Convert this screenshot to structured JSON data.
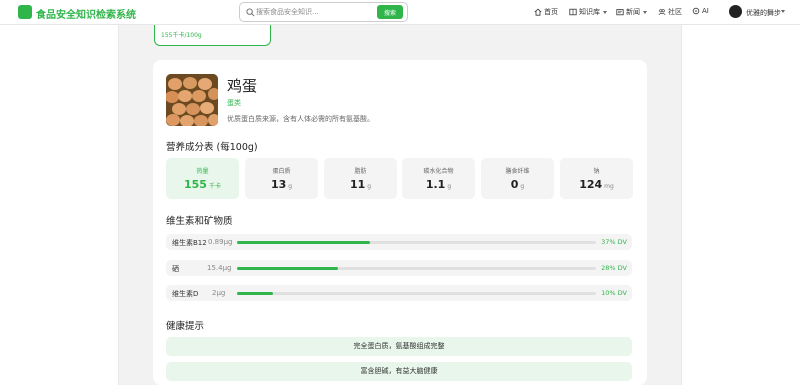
{
  "header": {
    "app_title": "食品安全知识检索系统",
    "search_placeholder": "搜索食品安全知识...",
    "search_button": "搜索",
    "nav": [
      {
        "label": "首页",
        "icon": "home-icon"
      },
      {
        "label": "知识库",
        "icon": "book-icon"
      },
      {
        "label": "新闻",
        "icon": "news-icon"
      },
      {
        "label": "社区",
        "icon": "community-icon"
      },
      {
        "label": "AI",
        "icon": "ai-icon"
      }
    ],
    "user_name": "优雅的舞步"
  },
  "prev_card": {
    "text": "155千卡/100g"
  },
  "food": {
    "name": "鸡蛋",
    "category": "蛋类",
    "description": "优质蛋白质来源，含有人体必需的所有氨基酸。"
  },
  "nutrition": {
    "title": "营养成分表 (每100g)",
    "items": [
      {
        "label": "热量",
        "value": "155",
        "unit": "千卡"
      },
      {
        "label": "蛋白质",
        "value": "13",
        "unit": "g"
      },
      {
        "label": "脂肪",
        "value": "11",
        "unit": "g"
      },
      {
        "label": "碳水化合物",
        "value": "1.1",
        "unit": "g"
      },
      {
        "label": "膳食纤维",
        "value": "0",
        "unit": "g"
      },
      {
        "label": "钠",
        "value": "124",
        "unit": "mg"
      }
    ]
  },
  "vitamins": {
    "title": "维生素和矿物质",
    "items": [
      {
        "name": "维生素B12",
        "amount": "0.89μg",
        "dv_label": "37% DV",
        "dv": 37
      },
      {
        "name": "硒",
        "amount": "15.4μg",
        "dv_label": "28% DV",
        "dv": 28
      },
      {
        "name": "维生素D",
        "amount": "2μg",
        "dv_label": "10% DV",
        "dv": 10
      }
    ]
  },
  "health": {
    "title": "健康提示",
    "tips": [
      "完全蛋白质，氨基酸组成完整",
      "富含胆碱，有益大脑健康"
    ]
  },
  "colors": {
    "accent": "#2fb54a",
    "highlight_bg": "#e8f6eb"
  }
}
